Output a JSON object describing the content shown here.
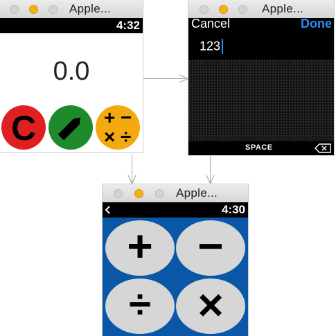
{
  "colors": {
    "clear_red": "#e02020",
    "edit_green": "#1f8a2c",
    "ops_orange": "#f3a90f",
    "ops_panel_blue": "#0a57a8",
    "done_blue": "#2b8ef5"
  },
  "window_main": {
    "title": "Apple...",
    "time": "4:32",
    "display_value": "0.0",
    "buttons": [
      {
        "name": "clear",
        "label": "C"
      },
      {
        "name": "edit",
        "icon": "pencil-icon"
      },
      {
        "name": "operations",
        "symbols": [
          "+",
          "−",
          "×",
          "÷"
        ]
      }
    ]
  },
  "window_input": {
    "title": "Apple...",
    "cancel_label": "Cancel",
    "done_label": "Done",
    "input_value": "123",
    "space_label": "SPACE",
    "delete_icon": "backspace-icon"
  },
  "window_ops": {
    "title": "Apple...",
    "back_icon": "chevron-left-icon",
    "time": "4:30",
    "operators": [
      {
        "name": "add",
        "symbol": "+"
      },
      {
        "name": "subtract",
        "symbol": "−"
      },
      {
        "name": "divide",
        "symbol": "÷"
      },
      {
        "name": "multiply",
        "symbol": "×"
      }
    ]
  }
}
